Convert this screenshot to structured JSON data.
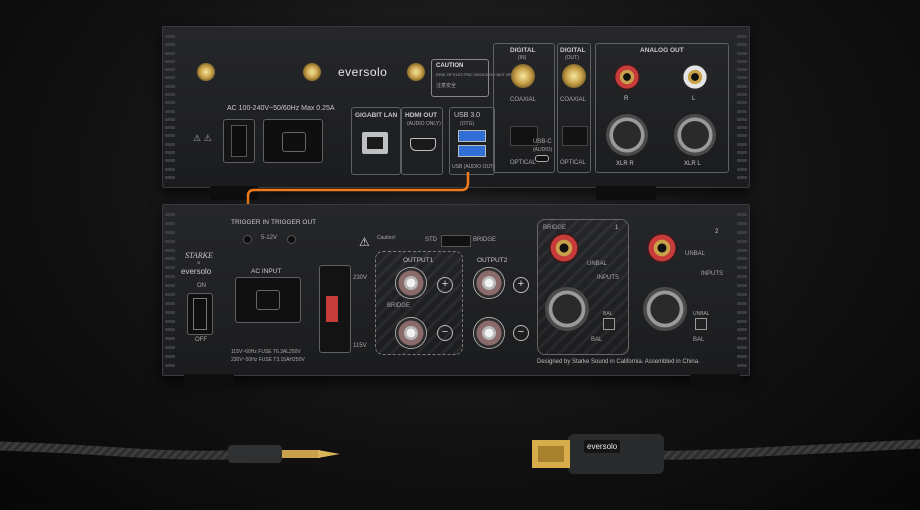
{
  "brand": "eversolo",
  "top_unit": {
    "power_label": "AC 100-240V~50/60Hz Max 0.25A",
    "caution_title": "CAUTION",
    "caution_text": "RISK OF ELECTRIC SHOCK DO NOT OPEN",
    "caution_cn": "注意安全",
    "gigabit_lan": "GIGABIT LAN",
    "hdmi_out": "HDMI OUT",
    "hdmi_sub": "(AUDIO ONLY)",
    "usb30": "USB 3.0",
    "usb30_sub": "(OTG)",
    "usb_audio_out": "USB (AUDIO OUT)",
    "digital_in": "DIGITAL",
    "digital_in_sub": "(IN)",
    "digital_out": "DIGITAL",
    "digital_out_sub": "(OUT)",
    "coaxial_1": "COAXIAL",
    "coaxial_2": "COAXIAL",
    "optical_1": "OPTICAL",
    "optical_2": "OPTICAL",
    "usbc": "USB-C",
    "usbc_sub": "(AUDIO)",
    "analog_out": "ANALOG OUT",
    "r": "R",
    "l": "L",
    "xlr_r": "XLR R",
    "xlr_l": "XLR L"
  },
  "bottom_unit": {
    "brand_starke": "STARKE",
    "x": "×",
    "trigger_in": "TRIGGER IN",
    "trigger_out": "TRIGGER OUT",
    "trigger_volt": "5-12V",
    "on": "ON",
    "off": "OFF",
    "ac_input": "AC INPUT",
    "v230": "230V",
    "v115": "115V",
    "fuse_1": "115V~60Hz FUSE T6.3AL250V",
    "fuse_2": "230V~50Hz FUSE T3.15AH250V",
    "caution": "Caution!",
    "std": "STD",
    "bridge_switch": "BRIDGE",
    "output1": "OUTPUT1",
    "output2": "OUTPUT2",
    "bridge": "BRIDGE",
    "bridge_box": "BRIDGE",
    "ch1": "1",
    "ch2": "2",
    "unbal_1": "UNBAL",
    "unbal_2": "UNBAL",
    "inputs_1": "INPUTS",
    "inputs_2": "INPUTS",
    "bal_1": "BAL",
    "bal_2": "BAL",
    "bal_small_1": "BAL",
    "bal_small_2": "BAL",
    "designed": "Designed by Starke Sound in California. Assembled in China."
  },
  "usb_plug_label": "eversolo",
  "colors": {
    "cable_orange": "#f07a1c",
    "usb_blue": "#2f6fd6",
    "rca_red": "#c83b3b",
    "gold": "#c9a14a"
  }
}
